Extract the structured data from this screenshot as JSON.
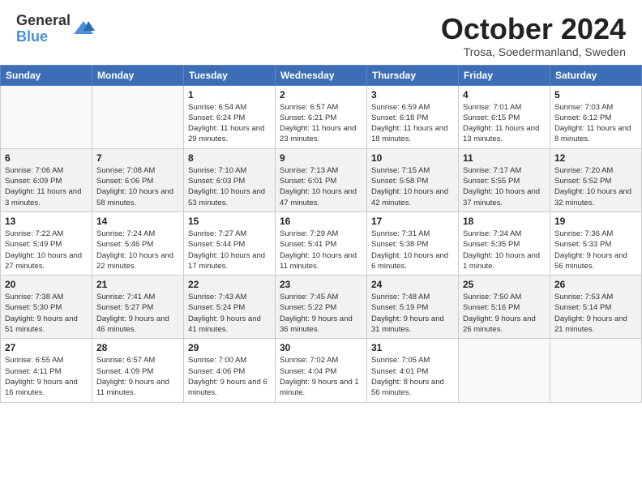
{
  "header": {
    "logo": {
      "general": "General",
      "blue": "Blue"
    },
    "title": "October 2024",
    "subtitle": "Trosa, Soedermanland, Sweden"
  },
  "weekdays": [
    "Sunday",
    "Monday",
    "Tuesday",
    "Wednesday",
    "Thursday",
    "Friday",
    "Saturday"
  ],
  "weeks": [
    [
      {
        "day": "",
        "sunrise": "",
        "sunset": "",
        "daylight": ""
      },
      {
        "day": "",
        "sunrise": "",
        "sunset": "",
        "daylight": ""
      },
      {
        "day": "1",
        "sunrise": "Sunrise: 6:54 AM",
        "sunset": "Sunset: 6:24 PM",
        "daylight": "Daylight: 11 hours and 29 minutes."
      },
      {
        "day": "2",
        "sunrise": "Sunrise: 6:57 AM",
        "sunset": "Sunset: 6:21 PM",
        "daylight": "Daylight: 11 hours and 23 minutes."
      },
      {
        "day": "3",
        "sunrise": "Sunrise: 6:59 AM",
        "sunset": "Sunset: 6:18 PM",
        "daylight": "Daylight: 11 hours and 18 minutes."
      },
      {
        "day": "4",
        "sunrise": "Sunrise: 7:01 AM",
        "sunset": "Sunset: 6:15 PM",
        "daylight": "Daylight: 11 hours and 13 minutes."
      },
      {
        "day": "5",
        "sunrise": "Sunrise: 7:03 AM",
        "sunset": "Sunset: 6:12 PM",
        "daylight": "Daylight: 11 hours and 8 minutes."
      }
    ],
    [
      {
        "day": "6",
        "sunrise": "Sunrise: 7:06 AM",
        "sunset": "Sunset: 6:09 PM",
        "daylight": "Daylight: 11 hours and 3 minutes."
      },
      {
        "day": "7",
        "sunrise": "Sunrise: 7:08 AM",
        "sunset": "Sunset: 6:06 PM",
        "daylight": "Daylight: 10 hours and 58 minutes."
      },
      {
        "day": "8",
        "sunrise": "Sunrise: 7:10 AM",
        "sunset": "Sunset: 6:03 PM",
        "daylight": "Daylight: 10 hours and 53 minutes."
      },
      {
        "day": "9",
        "sunrise": "Sunrise: 7:13 AM",
        "sunset": "Sunset: 6:01 PM",
        "daylight": "Daylight: 10 hours and 47 minutes."
      },
      {
        "day": "10",
        "sunrise": "Sunrise: 7:15 AM",
        "sunset": "Sunset: 5:58 PM",
        "daylight": "Daylight: 10 hours and 42 minutes."
      },
      {
        "day": "11",
        "sunrise": "Sunrise: 7:17 AM",
        "sunset": "Sunset: 5:55 PM",
        "daylight": "Daylight: 10 hours and 37 minutes."
      },
      {
        "day": "12",
        "sunrise": "Sunrise: 7:20 AM",
        "sunset": "Sunset: 5:52 PM",
        "daylight": "Daylight: 10 hours and 32 minutes."
      }
    ],
    [
      {
        "day": "13",
        "sunrise": "Sunrise: 7:22 AM",
        "sunset": "Sunset: 5:49 PM",
        "daylight": "Daylight: 10 hours and 27 minutes."
      },
      {
        "day": "14",
        "sunrise": "Sunrise: 7:24 AM",
        "sunset": "Sunset: 5:46 PM",
        "daylight": "Daylight: 10 hours and 22 minutes."
      },
      {
        "day": "15",
        "sunrise": "Sunrise: 7:27 AM",
        "sunset": "Sunset: 5:44 PM",
        "daylight": "Daylight: 10 hours and 17 minutes."
      },
      {
        "day": "16",
        "sunrise": "Sunrise: 7:29 AM",
        "sunset": "Sunset: 5:41 PM",
        "daylight": "Daylight: 10 hours and 11 minutes."
      },
      {
        "day": "17",
        "sunrise": "Sunrise: 7:31 AM",
        "sunset": "Sunset: 5:38 PM",
        "daylight": "Daylight: 10 hours and 6 minutes."
      },
      {
        "day": "18",
        "sunrise": "Sunrise: 7:34 AM",
        "sunset": "Sunset: 5:35 PM",
        "daylight": "Daylight: 10 hours and 1 minute."
      },
      {
        "day": "19",
        "sunrise": "Sunrise: 7:36 AM",
        "sunset": "Sunset: 5:33 PM",
        "daylight": "Daylight: 9 hours and 56 minutes."
      }
    ],
    [
      {
        "day": "20",
        "sunrise": "Sunrise: 7:38 AM",
        "sunset": "Sunset: 5:30 PM",
        "daylight": "Daylight: 9 hours and 51 minutes."
      },
      {
        "day": "21",
        "sunrise": "Sunrise: 7:41 AM",
        "sunset": "Sunset: 5:27 PM",
        "daylight": "Daylight: 9 hours and 46 minutes."
      },
      {
        "day": "22",
        "sunrise": "Sunrise: 7:43 AM",
        "sunset": "Sunset: 5:24 PM",
        "daylight": "Daylight: 9 hours and 41 minutes."
      },
      {
        "day": "23",
        "sunrise": "Sunrise: 7:45 AM",
        "sunset": "Sunset: 5:22 PM",
        "daylight": "Daylight: 9 hours and 36 minutes."
      },
      {
        "day": "24",
        "sunrise": "Sunrise: 7:48 AM",
        "sunset": "Sunset: 5:19 PM",
        "daylight": "Daylight: 9 hours and 31 minutes."
      },
      {
        "day": "25",
        "sunrise": "Sunrise: 7:50 AM",
        "sunset": "Sunset: 5:16 PM",
        "daylight": "Daylight: 9 hours and 26 minutes."
      },
      {
        "day": "26",
        "sunrise": "Sunrise: 7:53 AM",
        "sunset": "Sunset: 5:14 PM",
        "daylight": "Daylight: 9 hours and 21 minutes."
      }
    ],
    [
      {
        "day": "27",
        "sunrise": "Sunrise: 6:55 AM",
        "sunset": "Sunset: 4:11 PM",
        "daylight": "Daylight: 9 hours and 16 minutes."
      },
      {
        "day": "28",
        "sunrise": "Sunrise: 6:57 AM",
        "sunset": "Sunset: 4:09 PM",
        "daylight": "Daylight: 9 hours and 11 minutes."
      },
      {
        "day": "29",
        "sunrise": "Sunrise: 7:00 AM",
        "sunset": "Sunset: 4:06 PM",
        "daylight": "Daylight: 9 hours and 6 minutes."
      },
      {
        "day": "30",
        "sunrise": "Sunrise: 7:02 AM",
        "sunset": "Sunset: 4:04 PM",
        "daylight": "Daylight: 9 hours and 1 minute."
      },
      {
        "day": "31",
        "sunrise": "Sunrise: 7:05 AM",
        "sunset": "Sunset: 4:01 PM",
        "daylight": "Daylight: 8 hours and 56 minutes."
      },
      {
        "day": "",
        "sunrise": "",
        "sunset": "",
        "daylight": ""
      },
      {
        "day": "",
        "sunrise": "",
        "sunset": "",
        "daylight": ""
      }
    ]
  ]
}
